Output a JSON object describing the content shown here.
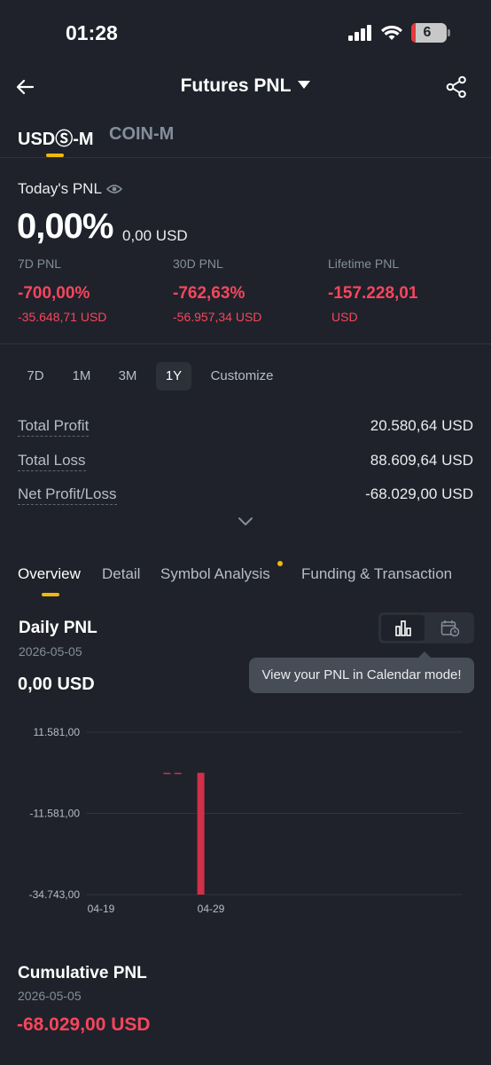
{
  "status_bar": {
    "time": "01:28",
    "battery": "6"
  },
  "header": {
    "title": "Futures PNL"
  },
  "market_tabs": [
    {
      "label": "USDⓈ-M",
      "active": true
    },
    {
      "label": "COIN-M",
      "active": false
    }
  ],
  "today": {
    "label": "Today's PNL",
    "percent": "0,00%",
    "usd": "0,00 USD"
  },
  "stats": [
    {
      "label": "7D PNL",
      "percent": "-700,00%",
      "usd": "-35.648,71 USD"
    },
    {
      "label": "30D PNL",
      "percent": "-762,63%",
      "usd": "-56.957,34 USD"
    },
    {
      "label": "Lifetime PNL",
      "percent": "-157.228,01",
      "usd": "USD"
    }
  ],
  "ranges": [
    {
      "label": "7D",
      "selected": false
    },
    {
      "label": "1M",
      "selected": false
    },
    {
      "label": "3M",
      "selected": false
    },
    {
      "label": "1Y",
      "selected": true
    },
    {
      "label": "Customize",
      "selected": false
    }
  ],
  "totals": [
    {
      "label": "Total Profit",
      "value": "20.580,64 USD"
    },
    {
      "label": "Total Loss",
      "value": "88.609,64 USD"
    },
    {
      "label": "Net Profit/Loss",
      "value": "-68.029,00 USD"
    }
  ],
  "section_tabs": [
    {
      "label": "Overview",
      "active": true
    },
    {
      "label": "Detail",
      "active": false
    },
    {
      "label": "Symbol Analysis",
      "active": false
    },
    {
      "label": "Funding & Transaction",
      "active": false
    }
  ],
  "daily": {
    "title": "Daily PNL",
    "date": "2026-05-05",
    "value": "0,00 USD",
    "tooltip": "View your PNL in Calendar mode!"
  },
  "chart_data": {
    "type": "bar",
    "y_tick_labels": [
      "11.581,00",
      "-11.581,00",
      "-34.743,00"
    ],
    "y_ticks": [
      11581,
      -11581,
      -34743
    ],
    "x_tick_labels": [
      "04-19",
      "04-29"
    ],
    "ylim": [
      -34743,
      11581
    ],
    "grid": true,
    "bar_color": "#cf304a",
    "series": [
      {
        "x": "04-28",
        "values": [
          -34743
        ]
      }
    ],
    "small_values": [
      {
        "x": "04-25",
        "value": -400
      },
      {
        "x": "04-26",
        "value": -400
      }
    ]
  },
  "cumulative": {
    "title": "Cumulative PNL",
    "date": "2026-05-05",
    "value": "-68.029,00 USD"
  },
  "colors": {
    "accent": "#f0b90b",
    "loss": "#f6465d",
    "background": "#1f222a"
  }
}
